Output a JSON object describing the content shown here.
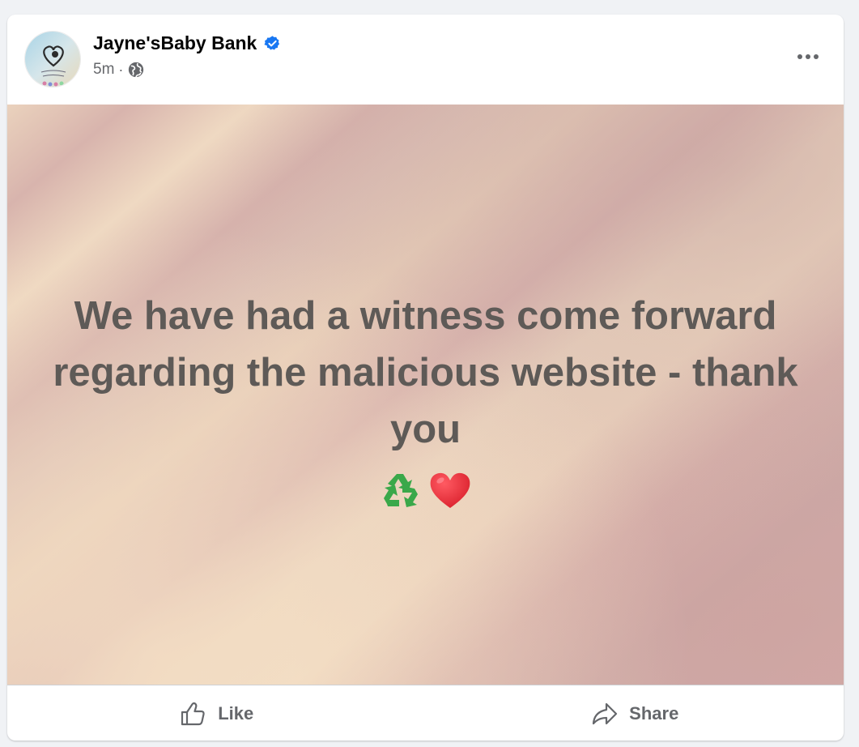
{
  "post": {
    "page_name": "Jayne'sBaby Bank",
    "verified": true,
    "timestamp": "5m",
    "separator": "·",
    "audience_icon": "globe-icon",
    "more_icon": "more-options-icon",
    "body_text": "We have had a witness come forward regarding the malicious website - thank you",
    "emojis": [
      "recycling-symbol",
      "red-heart"
    ]
  },
  "actions": {
    "like_label": "Like",
    "share_label": "Share"
  },
  "colors": {
    "verified_blue": "#1877f2",
    "secondary_text": "#65676b",
    "post_text": "#5e5a57",
    "heart_red": "#e0242f",
    "recycle_green": "#3aa84a"
  }
}
